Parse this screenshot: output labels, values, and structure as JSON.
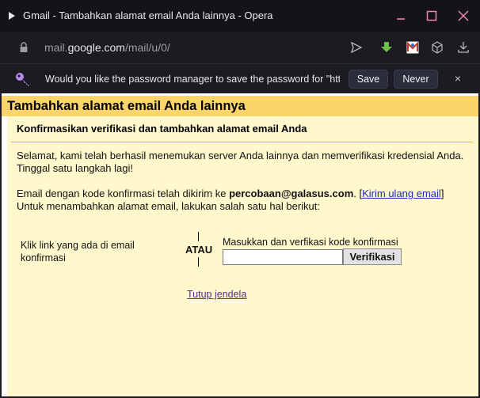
{
  "window": {
    "title": "Gmail - Tambahkan alamat email Anda lainnya - Opera"
  },
  "address": {
    "prefix": "mail.",
    "host": "google.com",
    "path": "/mail/u/0/"
  },
  "password_bar": {
    "message": "Would you like the password manager to save the password for \"htt...",
    "save_label": "Save",
    "never_label": "Never",
    "close_glyph": "×"
  },
  "page": {
    "heading": "Tambahkan alamat email Anda lainnya",
    "subheading": "Konfirmasikan verifikasi dan tambahkan alamat email Anda",
    "intro_line1": "Selamat, kami telah berhasil menemukan server Anda lainnya dan memverifikasi kredensial Anda.",
    "intro_line2": "Tinggal satu langkah lagi!",
    "sent_prefix": "Email dengan kode konfirmasi telah dikirim ke ",
    "sent_email": "percobaan@galasus.com",
    "sent_suffix": ". [",
    "resend_link": "Kirim ulang email",
    "sent_close_bracket": "]",
    "instruction": "Untuk menambahkan alamat email, lakukan salah satu hal berikut:",
    "option_link_text": "Klik link yang ada di email konfirmasi",
    "or_text": "ATAU",
    "code_label": "Masukkan dan verfikasi kode konfirmasi",
    "code_value": "",
    "verify_button": "Verifikasi",
    "close_window_link": "Tutup jendela"
  },
  "colors": {
    "header_bg": "#fbd46b",
    "panel_bg": "#fff8cc",
    "divider": "#e3b52e",
    "link": "#1b2cc0",
    "visited_link": "#5a2a8a"
  }
}
